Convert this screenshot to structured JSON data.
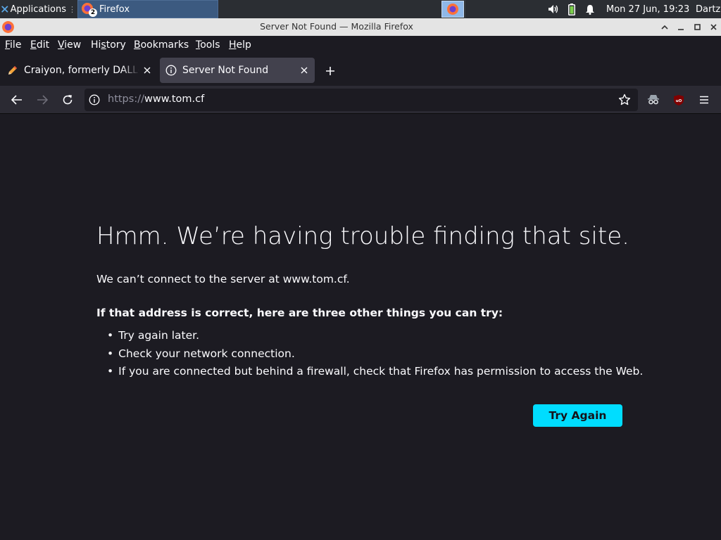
{
  "panel": {
    "applications_label": "Applications",
    "taskbar_item_label": "Firefox",
    "taskbar_item_badge": "2",
    "clock": "Mon 27 Jun, 19:23",
    "user": "Dartz"
  },
  "window": {
    "title": "Server Not Found — Mozilla Firefox"
  },
  "menubar": {
    "items": [
      {
        "accel": "F",
        "rest": "ile"
      },
      {
        "accel": "E",
        "rest": "dit"
      },
      {
        "accel": "V",
        "rest": "iew"
      },
      {
        "pre": "Hi",
        "accel": "s",
        "rest": "tory"
      },
      {
        "accel": "B",
        "rest": "ookmarks"
      },
      {
        "accel": "T",
        "rest": "ools"
      },
      {
        "accel": "H",
        "rest": "elp"
      }
    ]
  },
  "tabs": [
    {
      "label": "Craiyon, formerly DALL-E mini",
      "icon": "pencil-icon",
      "active": false
    },
    {
      "label": "Server Not Found",
      "icon": "info-icon",
      "active": true
    }
  ],
  "urlbar": {
    "prefix": "https://",
    "host": "www.tom.cf"
  },
  "error": {
    "title": "Hmm. We’re having trouble finding that site.",
    "description": "We can’t connect to the server at www.tom.cf.",
    "try_heading": "If that address is correct, here are three other things you can try:",
    "suggestions": [
      "Try again later.",
      "Check your network connection.",
      "If you are connected but behind a firewall, check that Firefox has permission to access the Web."
    ],
    "button_label": "Try Again"
  },
  "colors": {
    "accent": "#00ddff",
    "page_background": "#1c1b22",
    "toolbar_background": "#2b2a33",
    "active_tab": "#42414d",
    "panel_background": "#2b2e33",
    "taskbar_active": "#3c5a80"
  }
}
